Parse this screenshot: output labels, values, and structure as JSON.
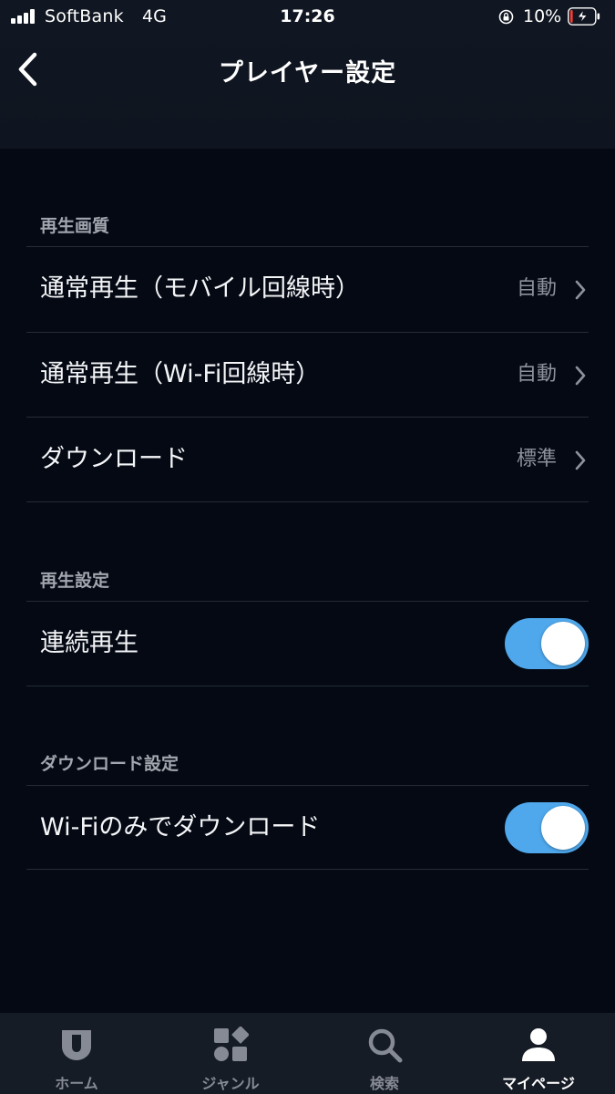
{
  "status_bar": {
    "carrier": "SoftBank",
    "network": "4G",
    "time": "17:26",
    "battery_percent": "10%",
    "battery_level": 0.1,
    "icons": [
      "signal-icon",
      "orientation-lock-icon",
      "battery-charging-icon"
    ]
  },
  "header": {
    "title": "プレイヤー設定",
    "back_icon": "chevron-left-icon"
  },
  "sections": {
    "quality": {
      "title": "再生画質",
      "rows": [
        {
          "label": "通常再生（モバイル回線時）",
          "value": "自動"
        },
        {
          "label": "通常再生（Wi-Fi回線時）",
          "value": "自動"
        },
        {
          "label": "ダウンロード",
          "value": "標準"
        }
      ]
    },
    "playback": {
      "title": "再生設定",
      "rows": [
        {
          "label": "連続再生",
          "enabled": true
        }
      ]
    },
    "download": {
      "title": "ダウンロード設定",
      "rows": [
        {
          "label": "Wi-Fiのみでダウンロード",
          "enabled": true
        }
      ]
    }
  },
  "tab_bar": {
    "tabs": [
      {
        "label": "ホーム",
        "icon": "home-shield-icon",
        "active": false
      },
      {
        "label": "ジャンル",
        "icon": "genre-grid-icon",
        "active": false
      },
      {
        "label": "検索",
        "icon": "search-icon",
        "active": false
      },
      {
        "label": "マイページ",
        "icon": "person-icon",
        "active": true
      }
    ]
  },
  "colors": {
    "background": "#040914",
    "header": "#111722",
    "toggle_on": "#4fa8ec",
    "divider": "#262c36",
    "tab_bar": "#161c26",
    "secondary_text": "#8d929b"
  }
}
